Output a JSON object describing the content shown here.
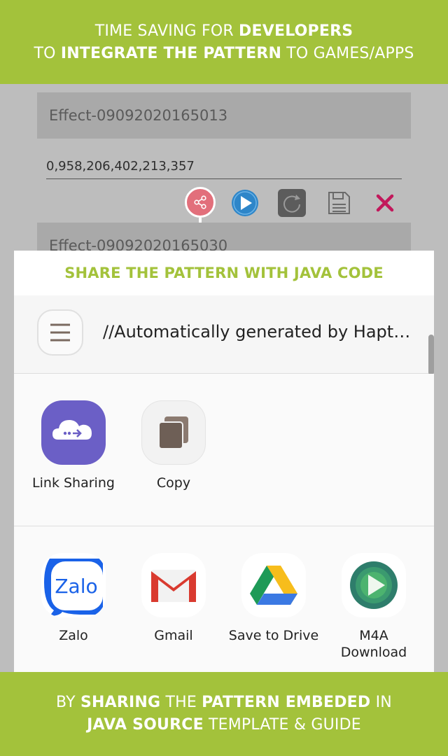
{
  "top_banner": {
    "line1_a": "TIME SAVING FOR ",
    "line1_b": "DEVELOPERS",
    "line2_a": "TO ",
    "line2_b": "INTEGRATE THE PATTERN",
    "line2_c": " TO GAMES/APPS"
  },
  "editor": {
    "effect1_name": "Effect-09092020165013",
    "effect1_value": "0,958,206,402,213,357",
    "effect2_name": "Effect-09092020165030",
    "tools": [
      "share-icon",
      "play-icon",
      "repeat-icon",
      "save-icon",
      "delete-icon"
    ]
  },
  "share_sheet": {
    "header": "SHARE THE PATTERN WITH JAVA CODE",
    "preview_text": "//Automatically generated by Haptic T...",
    "row1": [
      {
        "label": "Link Sharing",
        "icon": "link-sharing-icon"
      },
      {
        "label": "Copy",
        "icon": "copy-icon"
      }
    ],
    "row2": [
      {
        "label": "Zalo",
        "icon": "zalo-icon"
      },
      {
        "label": "Gmail",
        "icon": "gmail-icon"
      },
      {
        "label": "Save to Drive",
        "icon": "drive-icon"
      },
      {
        "label": "M4A\nDownload",
        "icon": "m4a-download-icon"
      }
    ]
  },
  "bottom_banner": {
    "l1_a": "BY ",
    "l1_b": "SHARING",
    "l1_c": " THE ",
    "l1_d": "PATTERN EMBEDED",
    "l1_e": " IN",
    "l2_a": "JAVA SOURCE",
    "l2_b": " TEMPLATE & GUIDE"
  },
  "colors": {
    "banner": "#a3c23b",
    "share_button": "#e26f7b",
    "play_button": "#2e86c9",
    "delete": "#c2185b"
  }
}
